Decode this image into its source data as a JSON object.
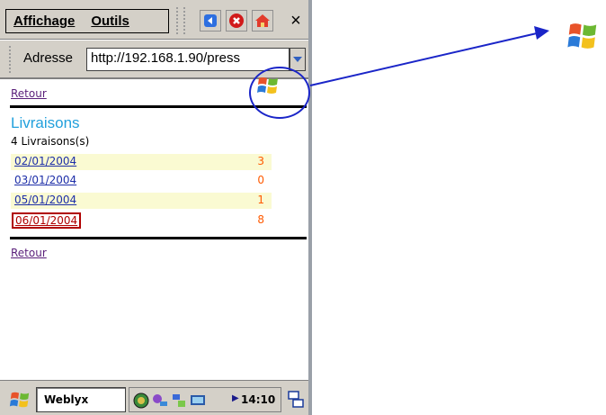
{
  "menubar": {
    "affichage_label": "Affichage",
    "outils_label": "Outils",
    "close_label": "×"
  },
  "addressbar": {
    "label": "Adresse",
    "url": "http://192.168.1.90/press"
  },
  "content": {
    "retour_top": "Retour",
    "title": "Livraisons",
    "count": "4 Livraisons(s)",
    "rows": [
      {
        "date": "02/01/2004",
        "qty": "3"
      },
      {
        "date": "03/01/2004",
        "qty": "0"
      },
      {
        "date": "05/01/2004",
        "qty": "1"
      },
      {
        "date": "06/01/2004",
        "qty": "8"
      }
    ],
    "retour_bottom": "Retour"
  },
  "taskbar": {
    "task_label": "Weblyx",
    "clock": "14:10"
  },
  "colors": {
    "title": "#22a0dc",
    "link_date": "#1e2fa8",
    "qty": "#ff5a00",
    "highlight_circle": "#1a25c8",
    "row_alt": "#fafad2"
  },
  "icons": {
    "back": "back-arrow-icon",
    "stop": "stop-icon",
    "home": "home-icon",
    "logo": "windows-flag-icon"
  }
}
